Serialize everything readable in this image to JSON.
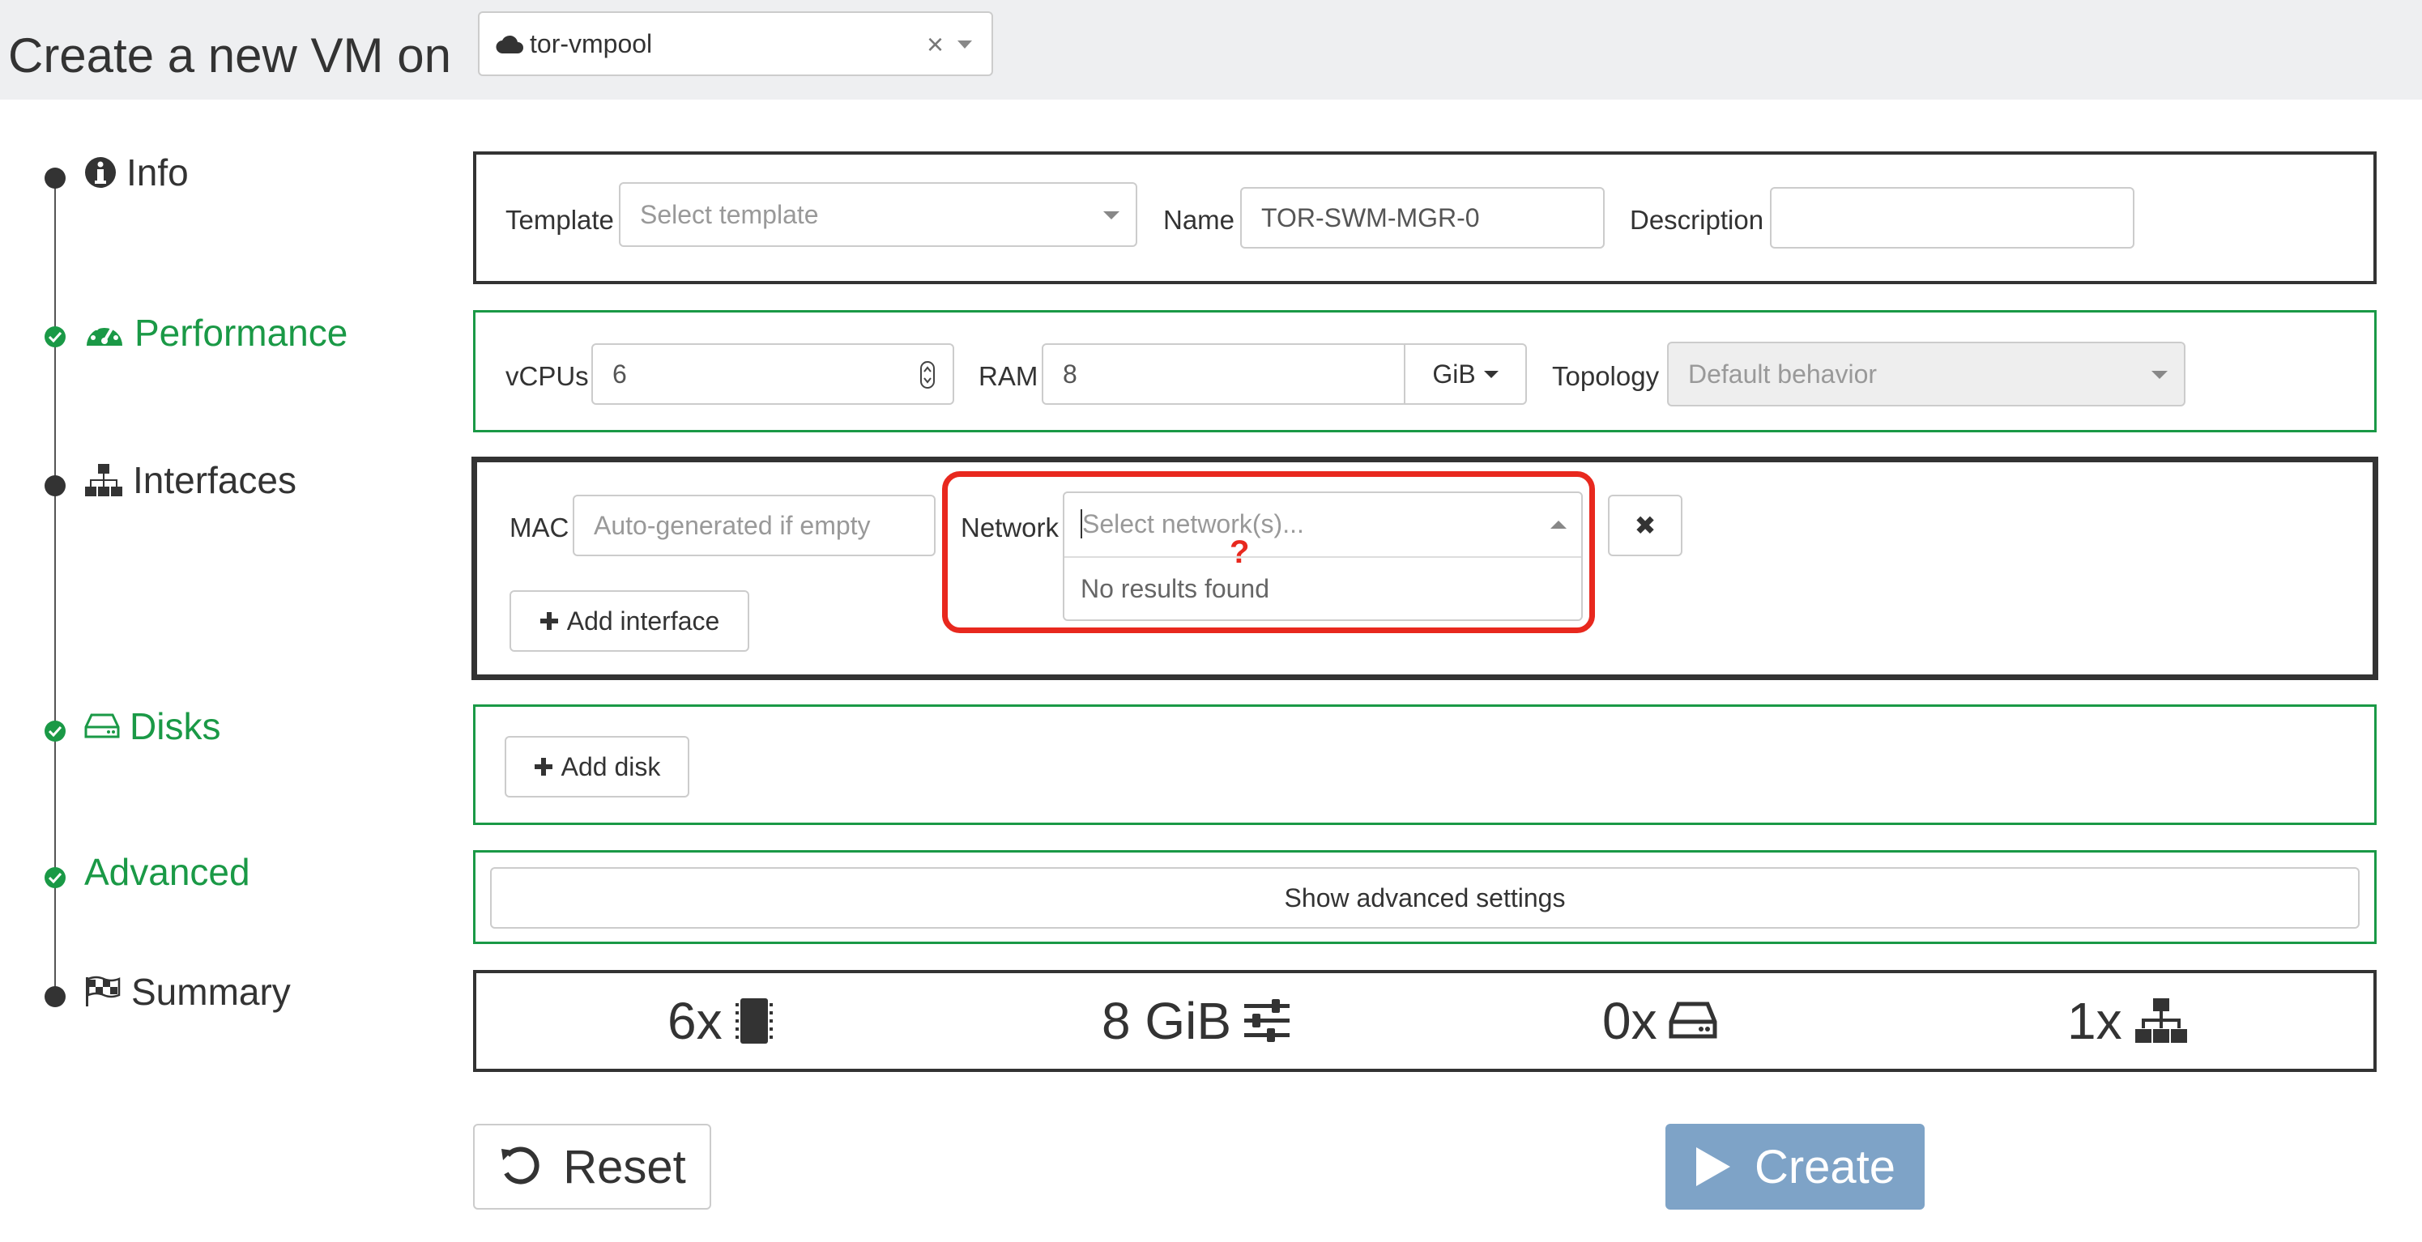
{
  "header": {
    "title": "Create a new VM on",
    "pool": {
      "value": "tor-vmpool",
      "clear": "×"
    }
  },
  "steps": {
    "info": {
      "label": "Info",
      "status": "pending"
    },
    "performance": {
      "label": "Performance",
      "status": "done"
    },
    "interfaces": {
      "label": "Interfaces",
      "status": "pending"
    },
    "disks": {
      "label": "Disks",
      "status": "done"
    },
    "advanced": {
      "label": "Advanced",
      "status": "done"
    },
    "summary": {
      "label": "Summary",
      "status": "pending"
    }
  },
  "info": {
    "template_label": "Template",
    "template_placeholder": "Select template",
    "name_label": "Name",
    "name_value": "TOR-SWM-MGR-0",
    "description_label": "Description",
    "description_value": ""
  },
  "performance": {
    "vcpus_label": "vCPUs",
    "vcpus_value": "6",
    "ram_label": "RAM",
    "ram_value": "8",
    "ram_unit": "GiB",
    "topology_label": "Topology",
    "topology_value": "Default behavior"
  },
  "interfaces": {
    "mac_label": "MAC",
    "mac_placeholder": "Auto-generated if empty",
    "network_label": "Network",
    "network_placeholder": "Select network(s)...",
    "no_results": "No results found",
    "annotation": "?",
    "remove": "✖",
    "add_label": "Add interface"
  },
  "disks": {
    "add_label": "Add disk"
  },
  "advanced": {
    "toggle_label": "Show advanced settings"
  },
  "summary": {
    "cpus": "6x",
    "ram": "8 GiB",
    "disks": "0x",
    "interfaces": "1x"
  },
  "actions": {
    "reset": "Reset",
    "create": "Create"
  },
  "colors": {
    "green": "#1a9946",
    "dark": "#333333",
    "highlight": "#e8281e",
    "create_bg": "#7ea3c7"
  }
}
